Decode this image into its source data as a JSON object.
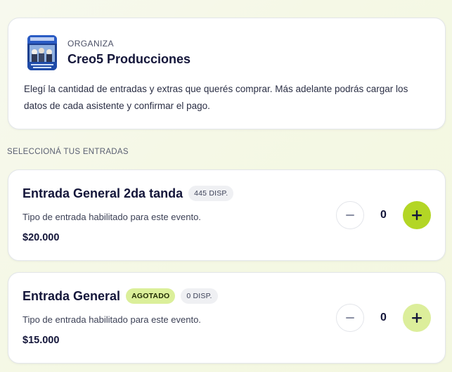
{
  "organizer": {
    "label": "ORGANIZA",
    "name": "Creo5 Producciones",
    "description": "Elegí la cantidad de entradas y extras que querés comprar. Más adelante podrás cargar los datos de cada asistente y confirmar el pago."
  },
  "section_title": "SELECCIONÁ TUS ENTRADAS",
  "tickets": [
    {
      "name": "Entrada General 2da tanda",
      "status_badge": "",
      "availability": "445 DISP.",
      "description": "Tipo de entrada habilitado para este evento.",
      "price": "$20.000",
      "quantity": "0"
    },
    {
      "name": "Entrada General",
      "status_badge": "AGOTADO",
      "availability": "0 DISP.",
      "description": "Tipo de entrada habilitado para este evento.",
      "price": "$15.000",
      "quantity": "0"
    }
  ],
  "colors": {
    "accent": "#b3d625",
    "accent_soft": "#dcee9b",
    "text": "#14163a"
  },
  "icons": [
    "minus-icon",
    "plus-icon"
  ]
}
